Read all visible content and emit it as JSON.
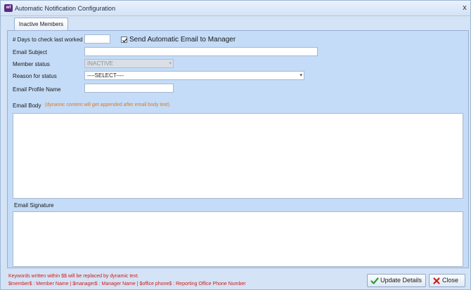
{
  "window": {
    "title": "Automatic Notification Configuration",
    "close_glyph": "x",
    "app_icon": "wf"
  },
  "tabs": [
    {
      "label": "Inactive Members",
      "active": true
    }
  ],
  "form": {
    "days_label": "# Days to check last worked",
    "days_value": "",
    "send_email_label": "Send Automatic Email to Manager",
    "send_email_checked": true,
    "subject_label": "Email Subject",
    "subject_value": "",
    "member_status_label": "Member status",
    "member_status_value": "INACTIVE",
    "reason_label": "Reason for status",
    "reason_value": "----SELECT----",
    "profile_label": "Email Profile Name",
    "profile_value": "",
    "body_label": "Email Body",
    "body_hint": "(dynamic content will get appended after email body text)",
    "signature_label": "Email Signature"
  },
  "footer": {
    "note_line1": "Keywords written within $$ will be replaced by dynamic text.",
    "note_line2": "$member$ : Member Name  |  $manager$ : Manager Name  |  $office phone$ : Reporting Office Phone Number"
  },
  "buttons": {
    "update_label": "Update Details",
    "close_label": "Close"
  },
  "icons": {
    "update": "green-check-icon",
    "close": "red-x-icon",
    "dropdown": "chevron-down-icon"
  },
  "colors": {
    "panel_bg": "#c4dcf7",
    "hint": "#e0781e",
    "footer_note": "#d01b1b",
    "update_icon": "#2e9a2e",
    "close_icon": "#d01b1b"
  }
}
